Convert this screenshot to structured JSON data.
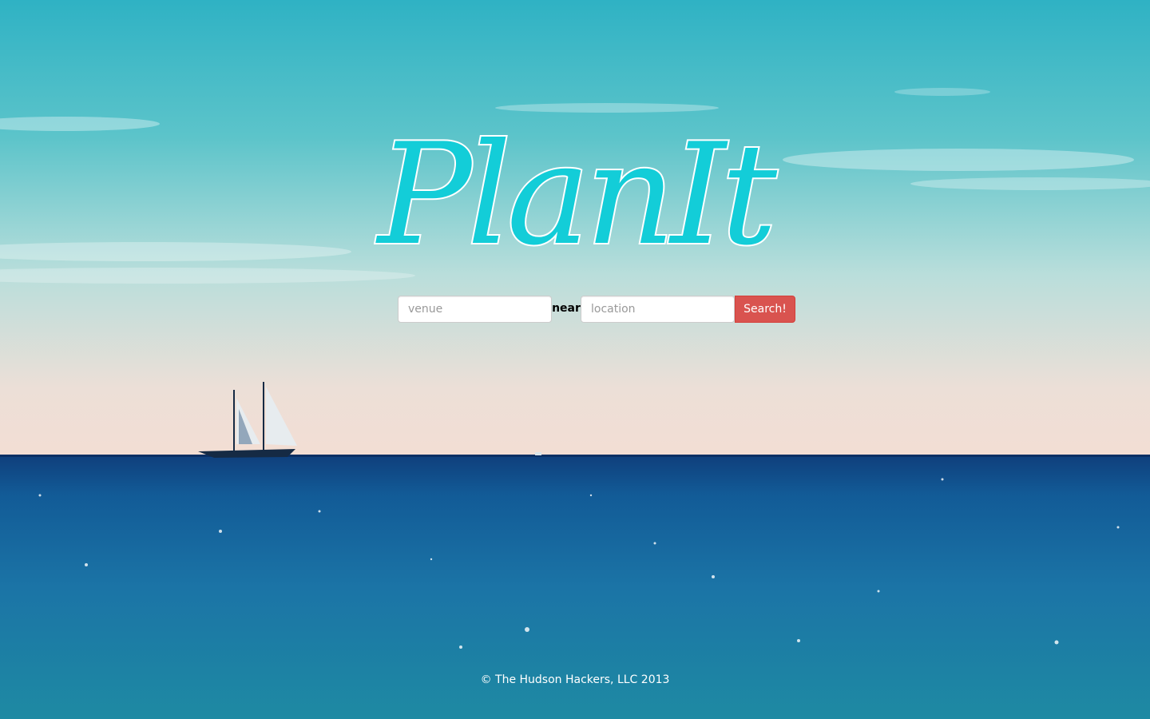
{
  "brand": {
    "logo_text": "PlanIt"
  },
  "search": {
    "venue_placeholder": "venue",
    "venue_value": "",
    "near_label": "near",
    "location_placeholder": "location",
    "location_value": "",
    "button_label": "Search!"
  },
  "footer": {
    "copyright": "© The Hudson Hackers, LLC 2013"
  },
  "colors": {
    "logo": "#13cdd8",
    "search_button": "#d9534f",
    "sky_top": "#38b6c6",
    "horizon": "#f0dfd6",
    "sea": "#11659a"
  },
  "background": {
    "scene": "sailboat on open sea under a teal sky"
  }
}
